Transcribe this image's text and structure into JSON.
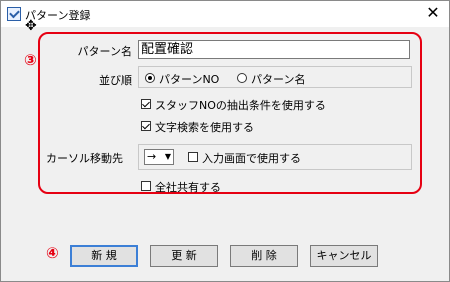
{
  "window": {
    "title": "パターン登録",
    "close_glyph": "✕"
  },
  "annotations": {
    "section3": "③",
    "section4": "④",
    "color": "#e60012"
  },
  "form": {
    "pattern_name_label": "パターン名",
    "pattern_name_value": "配置確認",
    "sort_label": "並び順",
    "sort_options": [
      {
        "label": "パターンNO",
        "selected": true
      },
      {
        "label": "パターン名",
        "selected": false
      }
    ],
    "checkbox_staff_no": {
      "label": "スタッフNOの抽出条件を使用する",
      "checked": true
    },
    "checkbox_text_search": {
      "label": "文字検索を使用する",
      "checked": true
    },
    "cursor_move_label": "カーソル移動先",
    "cursor_move_value": "→",
    "checkbox_input_screen": {
      "label": "入力画面で使用する",
      "checked": false
    },
    "checkbox_company_shared": {
      "label": "全社共有する",
      "checked": false
    }
  },
  "buttons": {
    "new": "新 規",
    "update": "更 新",
    "delete": "削 除",
    "cancel": "キャンセル"
  }
}
